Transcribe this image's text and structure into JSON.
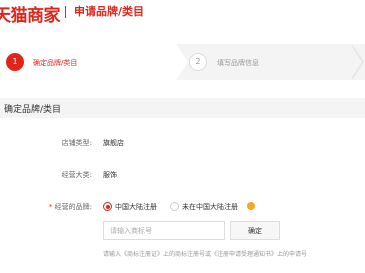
{
  "header": {
    "brand": "天猫商家",
    "title": "申请品牌/类目"
  },
  "stepper": {
    "steps": [
      {
        "number": "1",
        "label": "确定品牌/类目",
        "state": "active"
      },
      {
        "number": "2",
        "label": "填写品牌信息",
        "state": "pending"
      }
    ]
  },
  "section": {
    "title": "确定品牌/类目"
  },
  "form": {
    "shop_type": {
      "label": "店铺类型:",
      "value": "旗舰店"
    },
    "category": {
      "label": "经营大类:",
      "value": "服饰"
    },
    "brand": {
      "required_mark": "*",
      "label": "经营的品牌:",
      "options": [
        {
          "label": "中国大陆注册",
          "checked": true
        },
        {
          "label": "未在中国大陆注册",
          "checked": false
        }
      ],
      "input_placeholder": "请输入商标号",
      "confirm_label": "确定",
      "hint": "请输入《商标注册证》上的商标注册号或《注册申请受理通知书》上的申请号"
    }
  },
  "colors": {
    "accent": "#e1251b",
    "help_icon": "#f5a623"
  }
}
